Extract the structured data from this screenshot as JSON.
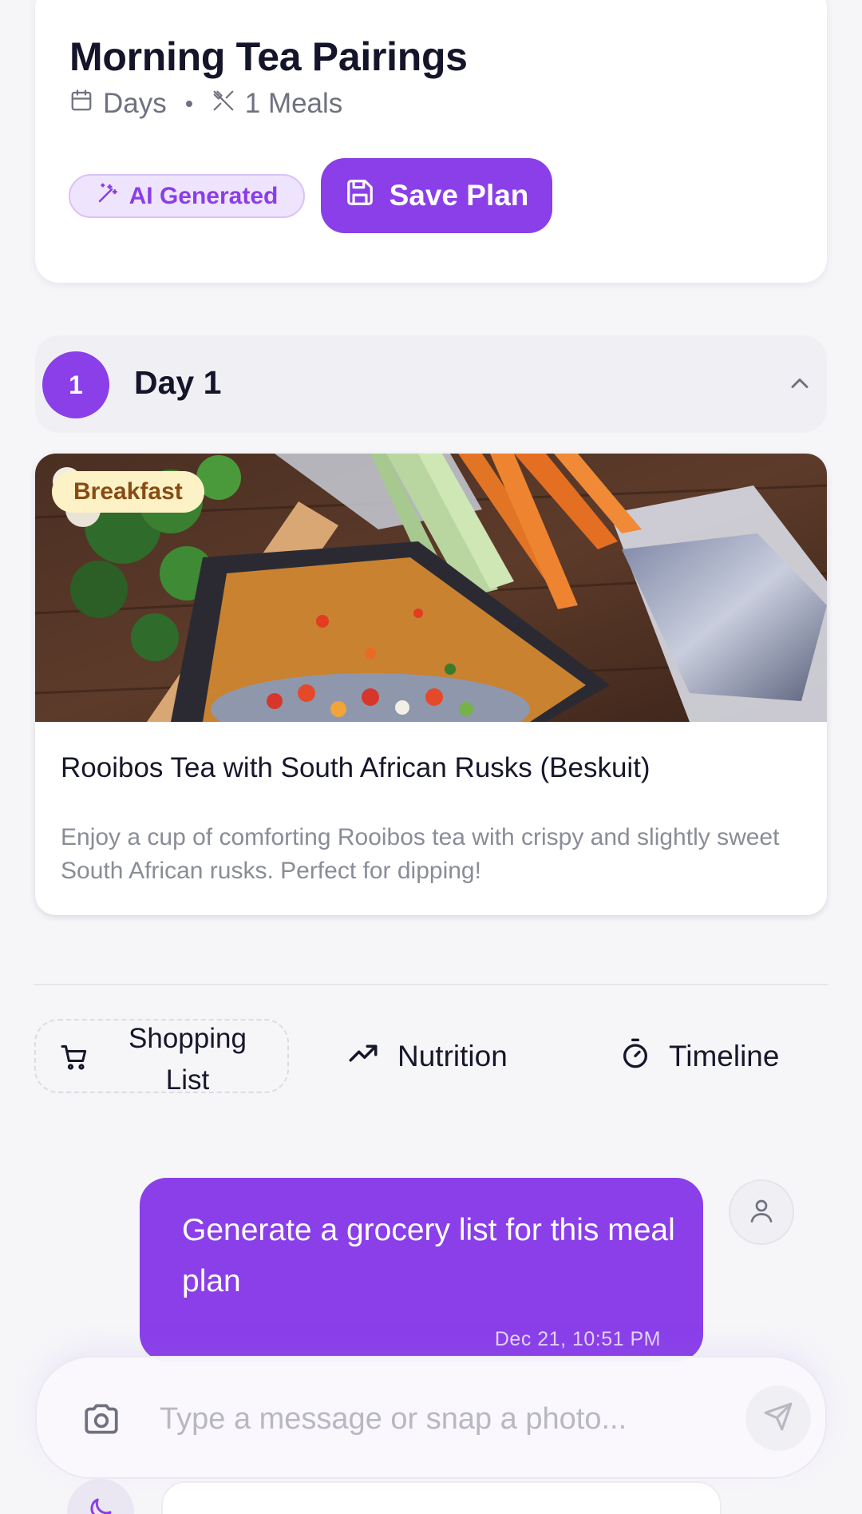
{
  "plan": {
    "title": "Morning Tea Pairings",
    "days_label": "Days",
    "meals_label": "1 Meals",
    "ai_badge": "AI Generated",
    "save_label": "Save Plan"
  },
  "day": {
    "number": "1",
    "title": "Day 1"
  },
  "meal": {
    "type_badge": "Breakfast",
    "name": "Rooibos Tea with South African Rusks (Beskuit)",
    "description": "Enjoy a cup of comforting Rooibos tea with crispy and slightly sweet South African rusks. Perfect for dipping!"
  },
  "actions": {
    "shopping_line1": "Shopping",
    "shopping_line2": "List",
    "nutrition": "Nutrition",
    "timeline": "Timeline"
  },
  "chat": {
    "message": "Generate a grocery list for this meal plan",
    "timestamp": "Dec 21, 10:51 PM"
  },
  "input": {
    "placeholder": "Type a message or snap a photo..."
  },
  "icons": {
    "days": "calendar-icon",
    "meals": "utensils-crossed-icon",
    "ai": "magic-wand-icon",
    "save": "floppy-disk-icon",
    "collapse": "chevron-up-icon",
    "shopping": "shopping-cart-icon",
    "nutrition": "trending-up-icon",
    "timeline": "stopwatch-icon",
    "avatar": "user-icon",
    "camera": "camera-icon",
    "send": "send-icon",
    "theme": "moon-icon"
  },
  "colors": {
    "accent": "#8a3fe9",
    "badge_breakfast_bg": "#fdf1c6",
    "badge_breakfast_text": "#874c14",
    "ai_badge_bg": "#efe4fd"
  }
}
